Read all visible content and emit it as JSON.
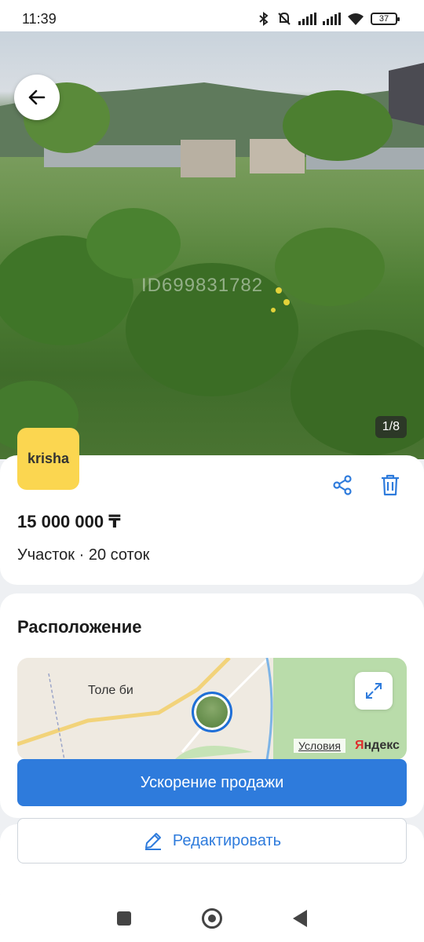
{
  "status_bar": {
    "time": "11:39",
    "battery": "37",
    "icons": [
      "bluetooth-icon",
      "mute-icon",
      "signal-icon",
      "signal-icon",
      "wifi-icon",
      "battery-icon"
    ]
  },
  "gallery": {
    "watermark": "ID699831782",
    "counter": "1/8"
  },
  "listing": {
    "logo_text": "krisha",
    "price": "15 000 000 ₸",
    "subtitle": "Участок · 20 соток"
  },
  "location": {
    "title": "Расположение",
    "map_town": "Толе би",
    "terms": "Условия",
    "provider": "Яндекс"
  },
  "actions": {
    "boost_label": "Ускорение продажи",
    "edit_label": "Редактировать"
  },
  "colors": {
    "accent": "#2e7bdc",
    "logo_bg": "#fbd650"
  }
}
